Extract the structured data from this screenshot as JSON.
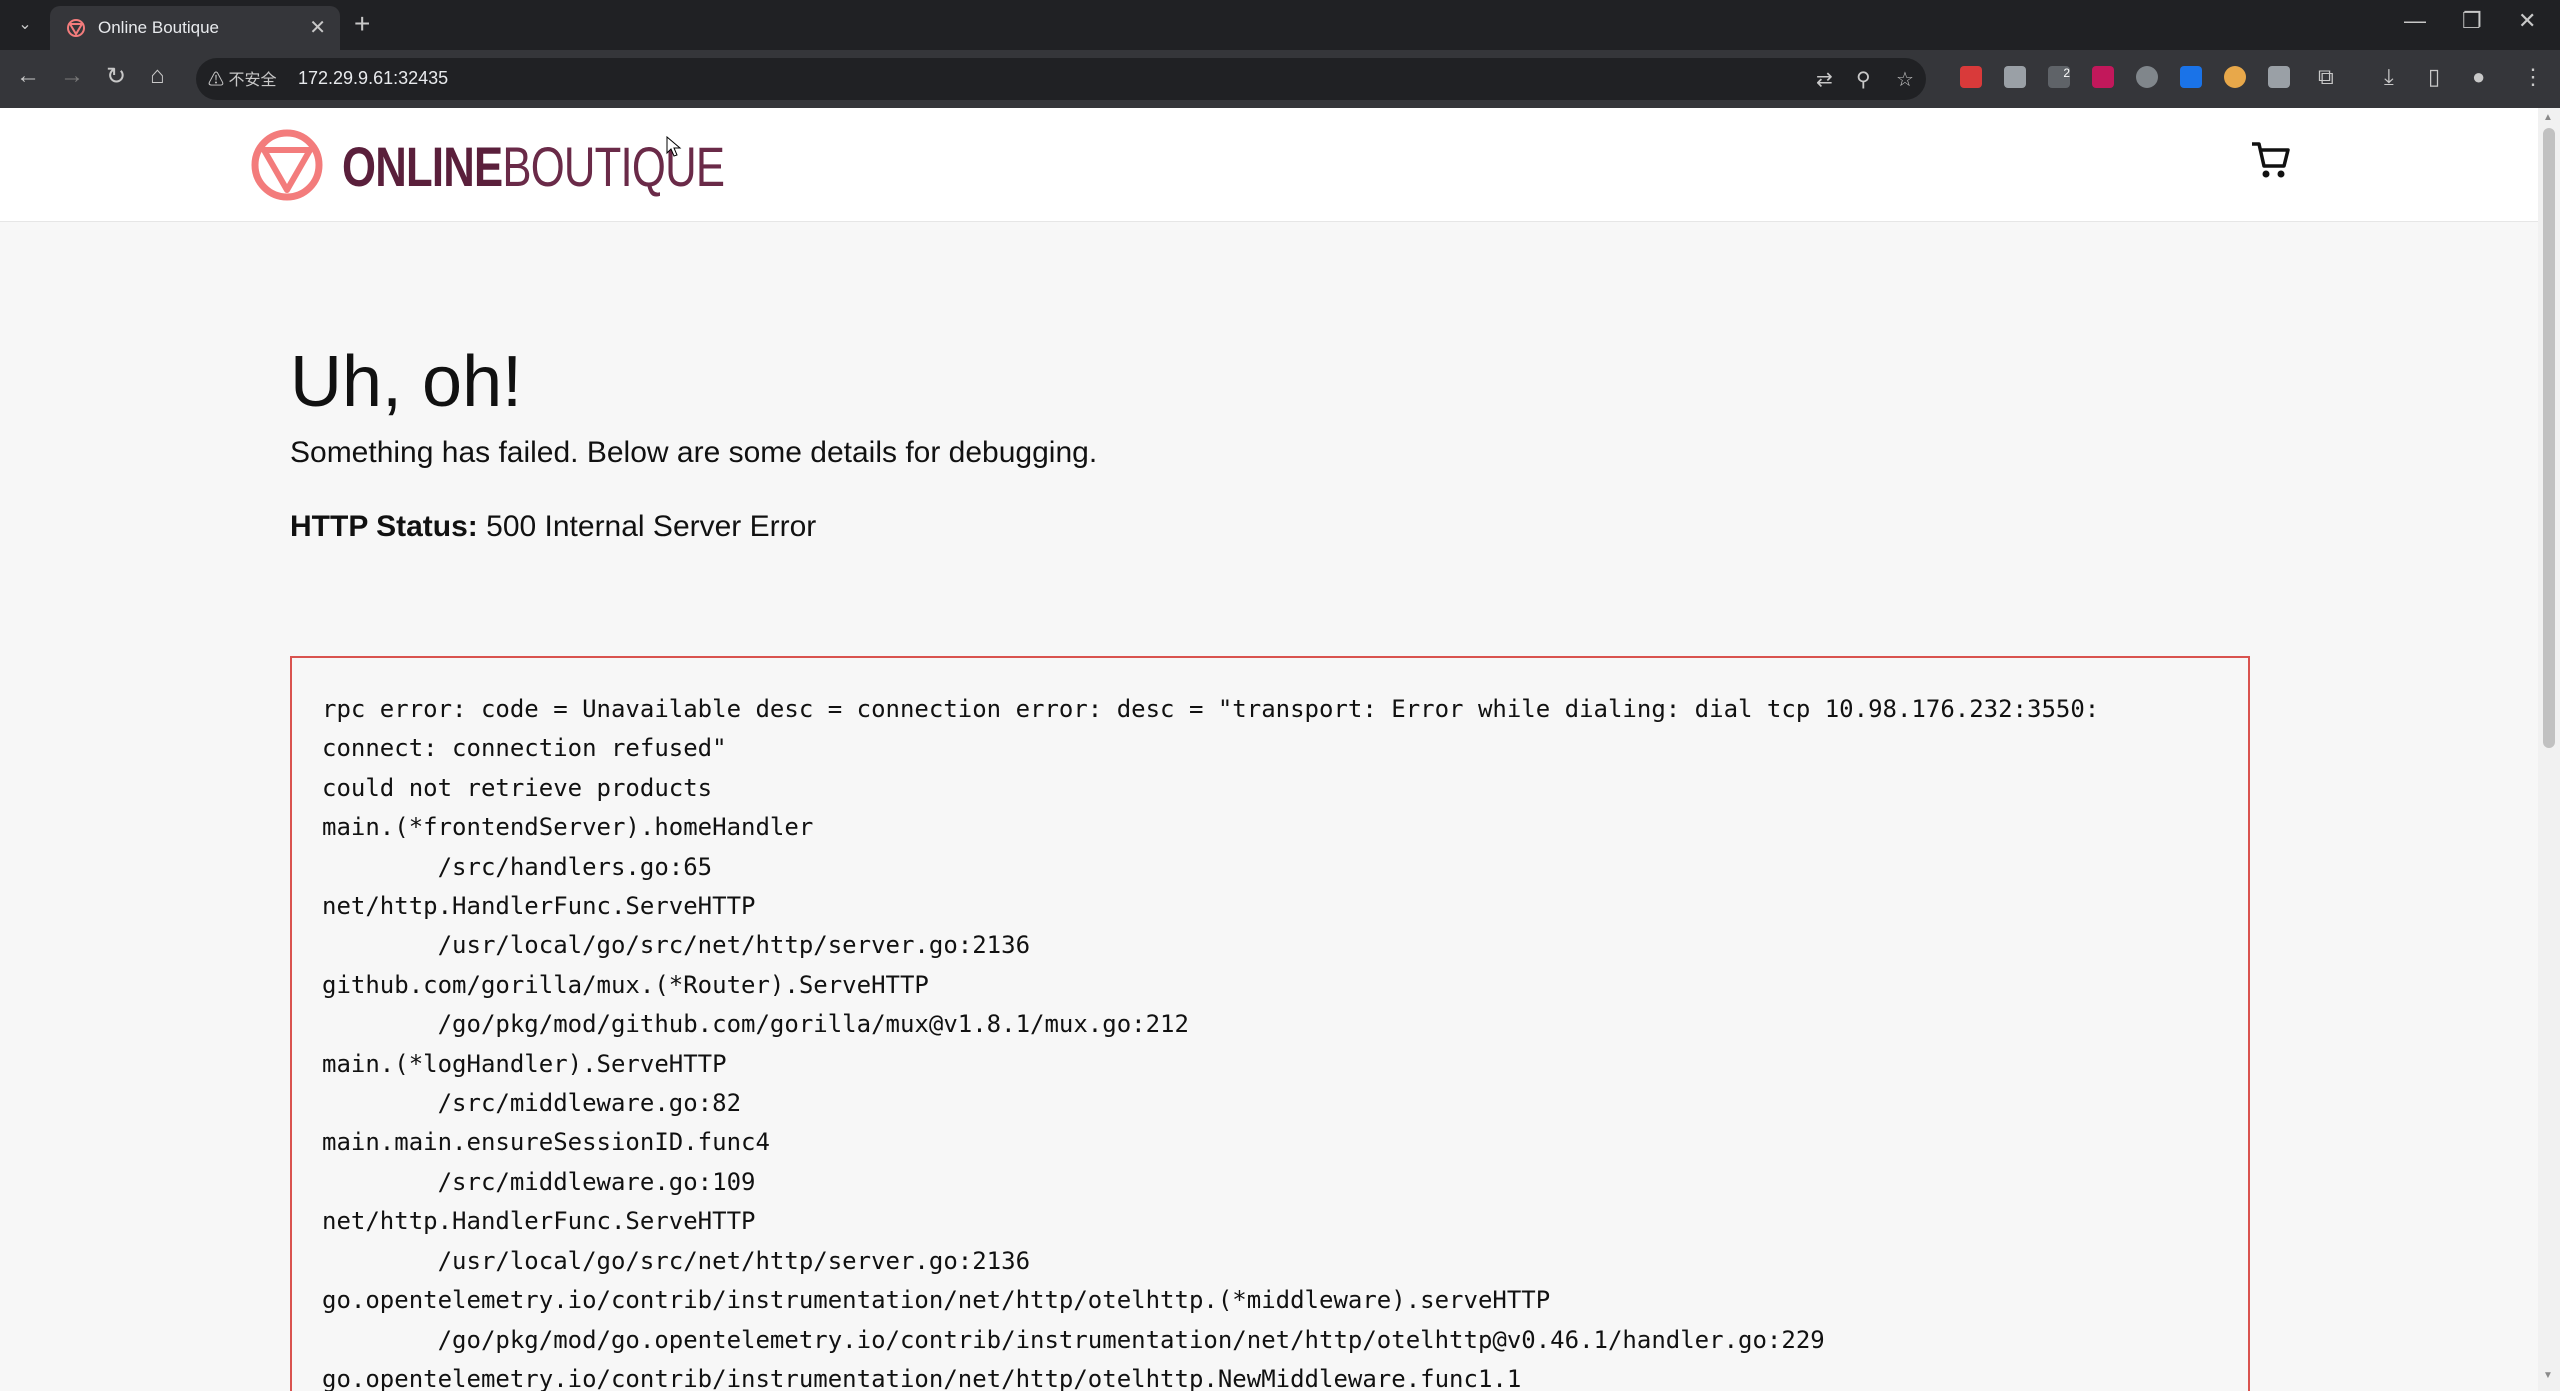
{
  "browser": {
    "tab_title": "Online Boutique",
    "tab_close": "✕",
    "new_tab": "+",
    "security_label": "不安全",
    "url": "172.29.9.61:32435",
    "window_controls": [
      "—",
      "❐",
      "✕"
    ],
    "icons": [
      "back-icon",
      "forward-icon",
      "reload-icon",
      "home-icon",
      "translate-icon",
      "zoom-icon",
      "bookmark-star-icon",
      "extensions-icon",
      "downloads-icon",
      "side-panel-icon",
      "profile-icon",
      "menu-icon"
    ],
    "extension_badge": "2"
  },
  "site": {
    "brand_bold": "ONLINE",
    "brand_light": "BOUTIQUE",
    "brand_color": "#5a1f3b",
    "logo_color": "#f37c7c",
    "cart_icon": "cart-icon"
  },
  "error": {
    "title": "Uh, oh!",
    "subtitle": "Something has failed. Below are some details for debugging.",
    "status_label": "HTTP Status:",
    "status_value": "500 Internal Server Error",
    "border_color": "#d9534f",
    "trace": [
      "rpc error: code = Unavailable desc = connection error: desc = \"transport: Error while dialing: dial tcp 10.98.176.232:3550:",
      "connect: connection refused\"",
      "could not retrieve products",
      "main.(*frontendServer).homeHandler",
      "        /src/handlers.go:65",
      "net/http.HandlerFunc.ServeHTTP",
      "        /usr/local/go/src/net/http/server.go:2136",
      "github.com/gorilla/mux.(*Router).ServeHTTP",
      "        /go/pkg/mod/github.com/gorilla/mux@v1.8.1/mux.go:212",
      "main.(*logHandler).ServeHTTP",
      "        /src/middleware.go:82",
      "main.main.ensureSessionID.func4",
      "        /src/middleware.go:109",
      "net/http.HandlerFunc.ServeHTTP",
      "        /usr/local/go/src/net/http/server.go:2136",
      "go.opentelemetry.io/contrib/instrumentation/net/http/otelhttp.(*middleware).serveHTTP",
      "        /go/pkg/mod/go.opentelemetry.io/contrib/instrumentation/net/http/otelhttp@v0.46.1/handler.go:229",
      "go.opentelemetry.io/contrib/instrumentation/net/http/otelhttp.NewMiddleware.func1.1"
    ]
  }
}
